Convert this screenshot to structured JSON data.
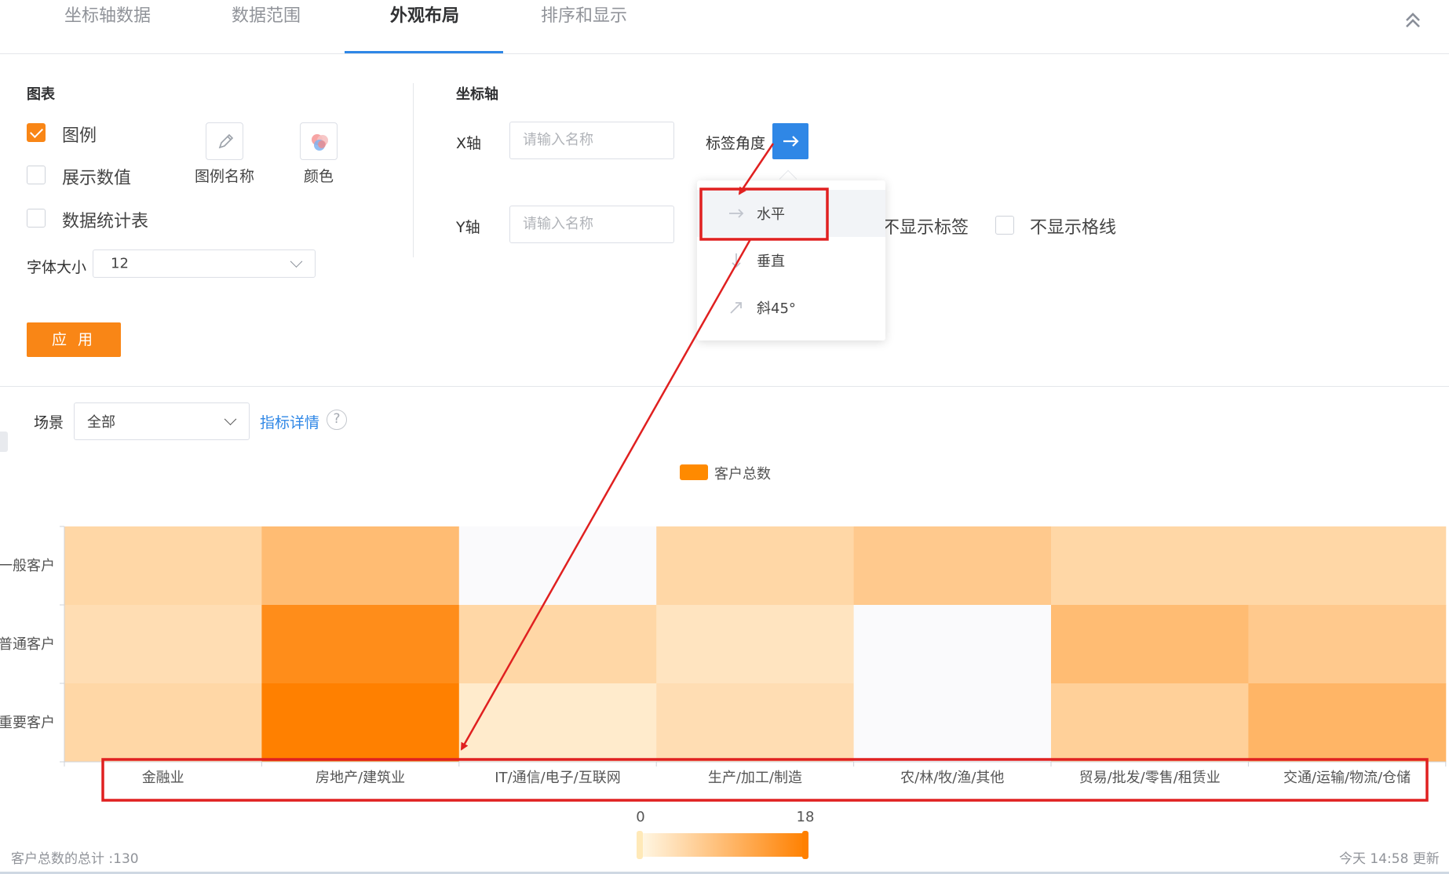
{
  "tabs": [
    {
      "label": "坐标轴数据"
    },
    {
      "label": "数据范围"
    },
    {
      "label": "外观布局"
    },
    {
      "label": "排序和显示"
    }
  ],
  "chart_panel": {
    "title": "图表",
    "legend_label": "图例",
    "legend_checked": true,
    "show_values_label": "展示数值",
    "show_values_checked": false,
    "stats_table_label": "数据统计表",
    "stats_table_checked": false,
    "legend_name_label": "图例名称",
    "color_label": "颜色",
    "font_size_label": "字体大小",
    "font_size_value": "12",
    "apply_label": "应 用"
  },
  "axis_panel": {
    "title": "坐标轴",
    "x_label": "X轴",
    "x_placeholder": "请输入名称",
    "label_angle_label": "标签角度",
    "y_label": "Y轴",
    "y_placeholder": "请输入名称",
    "hide_labels": "不显示标签",
    "hide_gridlines": "不显示格线",
    "angle_options": [
      {
        "label": "水平",
        "icon": "arrow-right-icon",
        "selected": true
      },
      {
        "label": "垂直",
        "icon": "arrow-down-icon",
        "selected": false
      },
      {
        "label": "斜45°",
        "icon": "arrow-up-right-icon",
        "selected": false
      }
    ]
  },
  "filter": {
    "scene_label": "场景",
    "scene_value": "全部",
    "detail_link": "指标详情",
    "help": "?"
  },
  "colors": {
    "accent": "#f98616",
    "link": "#2f87e6",
    "annotation": "#e02020"
  },
  "chart_data": {
    "type": "heatmap",
    "series_name": "客户总数",
    "x_categories": [
      "金融业",
      "房地产/建筑业",
      "IT/通信/电子/互联网",
      "生产/加工/制造",
      "农/林/牧/渔/其他",
      "贸易/批发/零售/租赁业",
      "交通/运输/物流/仓储"
    ],
    "y_categories": [
      "一般客户",
      "普通客户",
      "重要客户"
    ],
    "values": [
      [
        5,
        9,
        0,
        5,
        7,
        5,
        5
      ],
      [
        4,
        16,
        5,
        3,
        0,
        9,
        7
      ],
      [
        5,
        18,
        2,
        4,
        0,
        6,
        10
      ]
    ],
    "color_scale": {
      "min": 0,
      "max": 18,
      "low_color": "#fff8e6",
      "high_color": "#ff8000"
    },
    "scale_min_label": "0",
    "scale_max_label": "18",
    "legend_position": "top-center"
  },
  "footer": {
    "total": "客户总数的总计 :130",
    "updated": "今天 14:58 更新"
  }
}
